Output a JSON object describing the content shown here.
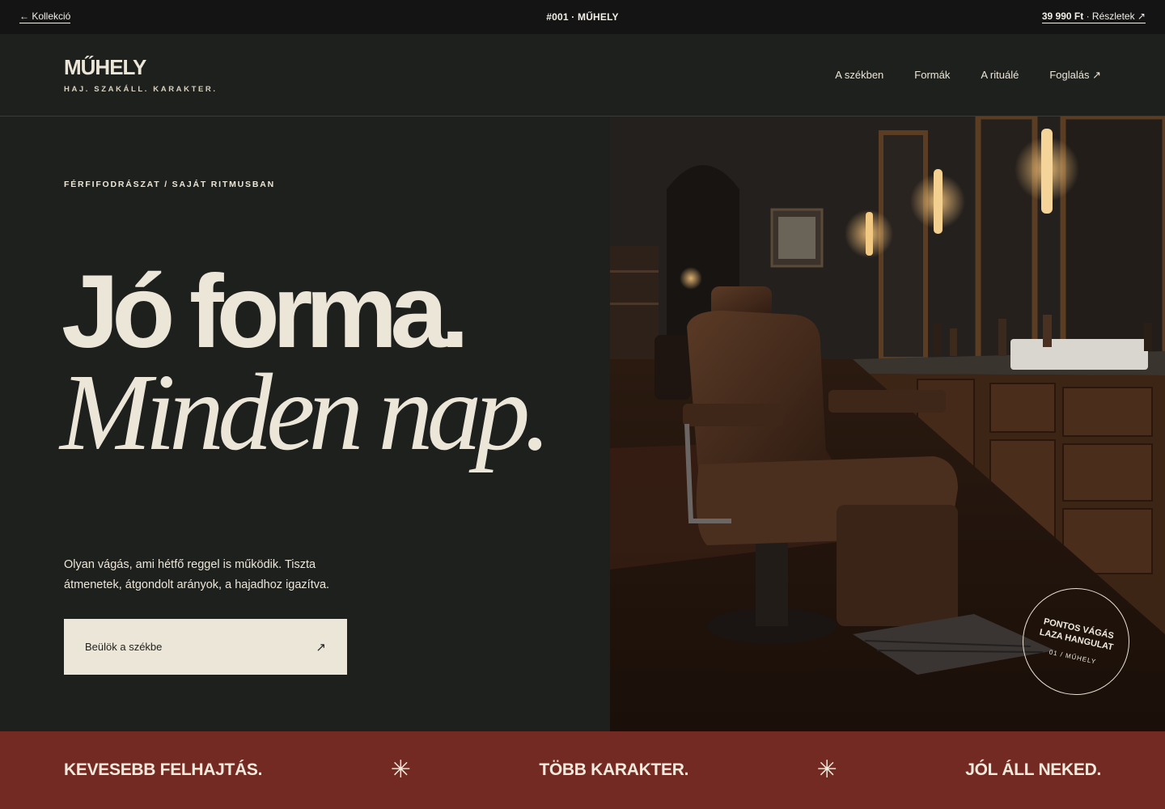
{
  "topbar": {
    "back_label": "← Kollekció",
    "center_label": "#001 · MŰHELY",
    "price": "39 990 Ft",
    "details_label": " · Részletek ↗"
  },
  "header": {
    "logo": "MŰHELY",
    "tagline": "HAJ. SZAKÁLL. KARAKTER.",
    "nav": [
      {
        "label": "A székben"
      },
      {
        "label": "Formák"
      },
      {
        "label": "A rituálé"
      },
      {
        "label": "Foglalás ↗"
      }
    ]
  },
  "hero": {
    "eyebrow": "FÉRFIFODRÁSZAT / SAJÁT RITMUSBAN",
    "headline_line1": "Jó forma.",
    "headline_line2": "Minden nap.",
    "lede": "Olyan vágás, ami hétfő reggel is működik. Tiszta átmenetek, átgondolt arányok, a hajadhoz igazítva.",
    "cta_label": "Beülök a székbe",
    "cta_arrow": "↗"
  },
  "badge": {
    "line1": "PONTOS VÁGÁS",
    "line2": "LAZA HANGULAT",
    "line3": "01 / MŰHELY"
  },
  "band": {
    "phrase1": "KEVESEBB FELHAJTÁS.",
    "phrase2": "TÖBB KARAKTER.",
    "phrase3": "JÓL ÁLL NEKED.",
    "separator": "✳"
  },
  "colors": {
    "background": "#1e201e",
    "topbar": "#141414",
    "cream": "#ece6d8",
    "band": "#722a22"
  }
}
